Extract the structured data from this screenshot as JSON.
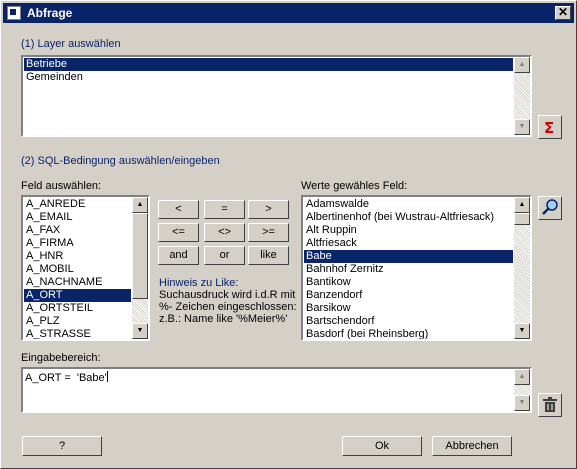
{
  "window": {
    "title": "Abfrage",
    "close_label": "✕"
  },
  "layer": {
    "heading": "(1) Layer auswählen",
    "items": [
      "Betriebe",
      "Gemeinden"
    ],
    "selected": "Betriebe"
  },
  "sql": {
    "heading": "(2) SQL-Bedingung auswählen/eingeben"
  },
  "fields": {
    "label": "Feld auswählen:",
    "items": [
      "A_ANREDE",
      "A_EMAIL",
      "A_FAX",
      "A_FIRMA",
      "A_HNR",
      "A_MOBIL",
      "A_NACHNAME",
      "A_ORT",
      "A_ORTSTEIL",
      "A_PLZ",
      "A_STRASSE"
    ],
    "selected": "A_ORT"
  },
  "operators": {
    "lt": "<",
    "eq": "=",
    "gt": ">",
    "le": "<=",
    "ne": "<>",
    "ge": ">=",
    "and": "and",
    "or": "or",
    "like": "like"
  },
  "hint": {
    "heading": "Hinweis zu Like:",
    "lines": [
      "Suchausdruck wird i.d.R mit",
      "%- Zeichen eingeschlossen:",
      "z.B.: Name like '%Meier%'"
    ]
  },
  "values": {
    "label": "Werte gewähles Feld:",
    "items": [
      "Adamswalde",
      "Albertinenhof (bei Wustrau-Altfriesack)",
      "Alt Ruppin",
      "Altfriesack",
      "Babe",
      "Bahnhof Zernitz",
      "Bantikow",
      "Banzendorf",
      "Barsikow",
      "Bartschendorf",
      "Basdorf (bei Rheinsberg)"
    ],
    "selected": "Babe"
  },
  "input": {
    "label": "Eingabebereich:",
    "value": "A_ORT =  'Babe'"
  },
  "buttons": {
    "help": "?",
    "ok": "Ok",
    "cancel": "Abbrechen"
  },
  "icons": {
    "sum": "sigma-icon",
    "search": "magnifier-icon",
    "delete": "trash-icon"
  },
  "colors": {
    "titlebar": "#0a246a",
    "selection": "#0a246a",
    "heading": "#0a246a",
    "sum_icon": "#cc0000"
  }
}
